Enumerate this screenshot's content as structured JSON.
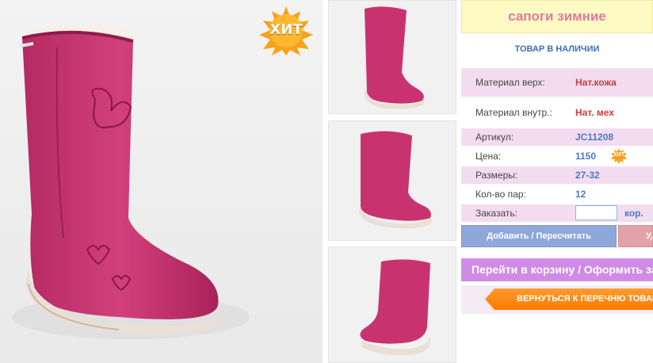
{
  "product": {
    "hit_label": "ХИТ",
    "title": "сапоги зимние",
    "stock_status": "ТОВАР В НАЛИЧИИ"
  },
  "specs": {
    "material_top_label": "Материал верх:",
    "material_top_value": "Нат.кожа",
    "material_inner_label": "Материал внутр.:",
    "material_inner_value": "Нат. мех",
    "article_label": "Артикул:",
    "article_value": "JC11208",
    "price_label": "Цена:",
    "price_value": "1150",
    "price_hit": "ХИТ",
    "sizes_label": "Размеры:",
    "sizes_value": "27-32",
    "pairs_label": "Кол-во пар:",
    "pairs_value": "12",
    "order_label": "Заказать:",
    "order_value": "",
    "order_unit": "кор."
  },
  "actions": {
    "add_label": "Добавить / Пересчитать",
    "delete_label": "Удалить",
    "cart_label": "Перейти в корзину / Оформить заказ",
    "back_label": "ВЕРНУТЬСЯ К ПЕРЕЧНЮ ТОВАРОВ"
  },
  "colors": {
    "boot": "#c8336f",
    "title_bg": "#fff9c4",
    "title_text": "#e07a9c",
    "row_pink": "#f4dcf0",
    "cart_btn": "#cf8be6",
    "back_btn": "#ff7a00",
    "add_btn": "#8fa8d9"
  }
}
